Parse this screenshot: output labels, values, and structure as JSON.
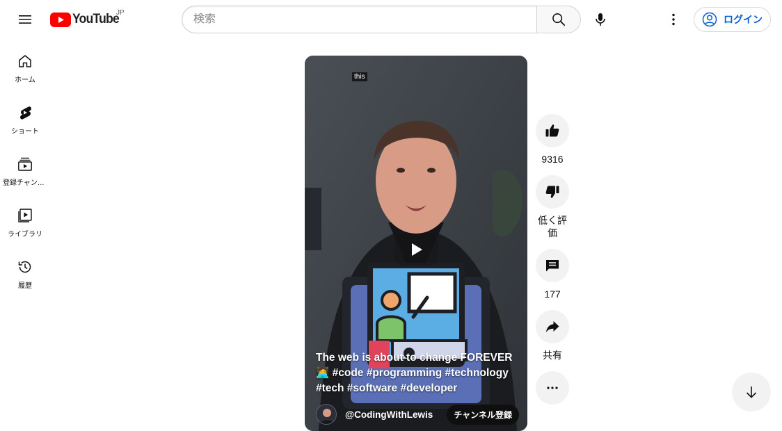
{
  "header": {
    "logo_text": "YouTube",
    "region": "JP",
    "search_placeholder": "検索",
    "login_label": "ログイン"
  },
  "sidebar": {
    "items": [
      {
        "label": "ホーム",
        "icon": "home-icon"
      },
      {
        "label": "ショート",
        "icon": "shorts-icon"
      },
      {
        "label": "登録チャンネル",
        "icon": "subscriptions-icon"
      },
      {
        "label": "ライブラリ",
        "icon": "library-icon"
      },
      {
        "label": "履歴",
        "icon": "history-icon"
      }
    ]
  },
  "short": {
    "caption_word": "this",
    "title": "The web is about to change FOREVER 🧑‍💻 #code #programming #technology #tech #software #developer",
    "channel": "@CodingWithLewis",
    "subscribe_label": "チャンネル登録"
  },
  "actions": {
    "like_count": "9316",
    "dislike_label": "低く評価",
    "comment_count": "177",
    "share_label": "共有"
  },
  "colors": {
    "brand_red": "#ff0000",
    "link_blue": "#065fd4",
    "action_bg": "#f2f2f2"
  }
}
